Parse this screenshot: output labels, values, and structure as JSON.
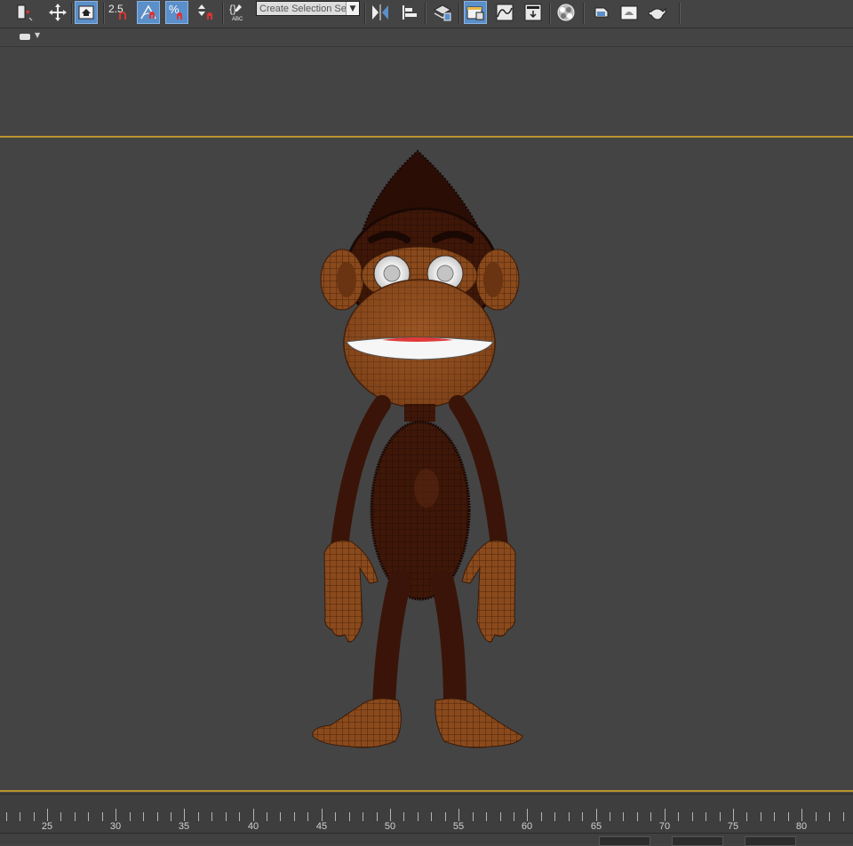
{
  "toolbar": {
    "snap_value": "2.5",
    "selection_set_placeholder": "Create Selection Se",
    "icons": [
      "select-filter-icon",
      "move-icon",
      "select-window-icon",
      "snap-toggle-icon",
      "angle-snap-icon",
      "percent-snap-icon",
      "spinner-snap-icon",
      "edit-named-sets-icon",
      "mirror-icon",
      "align-icon",
      "layer-manager-icon",
      "scene-explorer-icon",
      "curve-editor-icon",
      "schematic-view-icon",
      "material-editor-icon",
      "render-setup-icon",
      "rendered-frame-icon",
      "render-teapot-icon",
      "render-iterative-icon"
    ]
  },
  "timeline": {
    "labels": [
      "25",
      "30",
      "35",
      "40",
      "45",
      "50",
      "55",
      "60",
      "65",
      "70",
      "75",
      "80"
    ]
  },
  "colors": {
    "viewport_bg": "#444444",
    "viewport_border": "#b8952e",
    "active_button": "#5b8fc9"
  }
}
